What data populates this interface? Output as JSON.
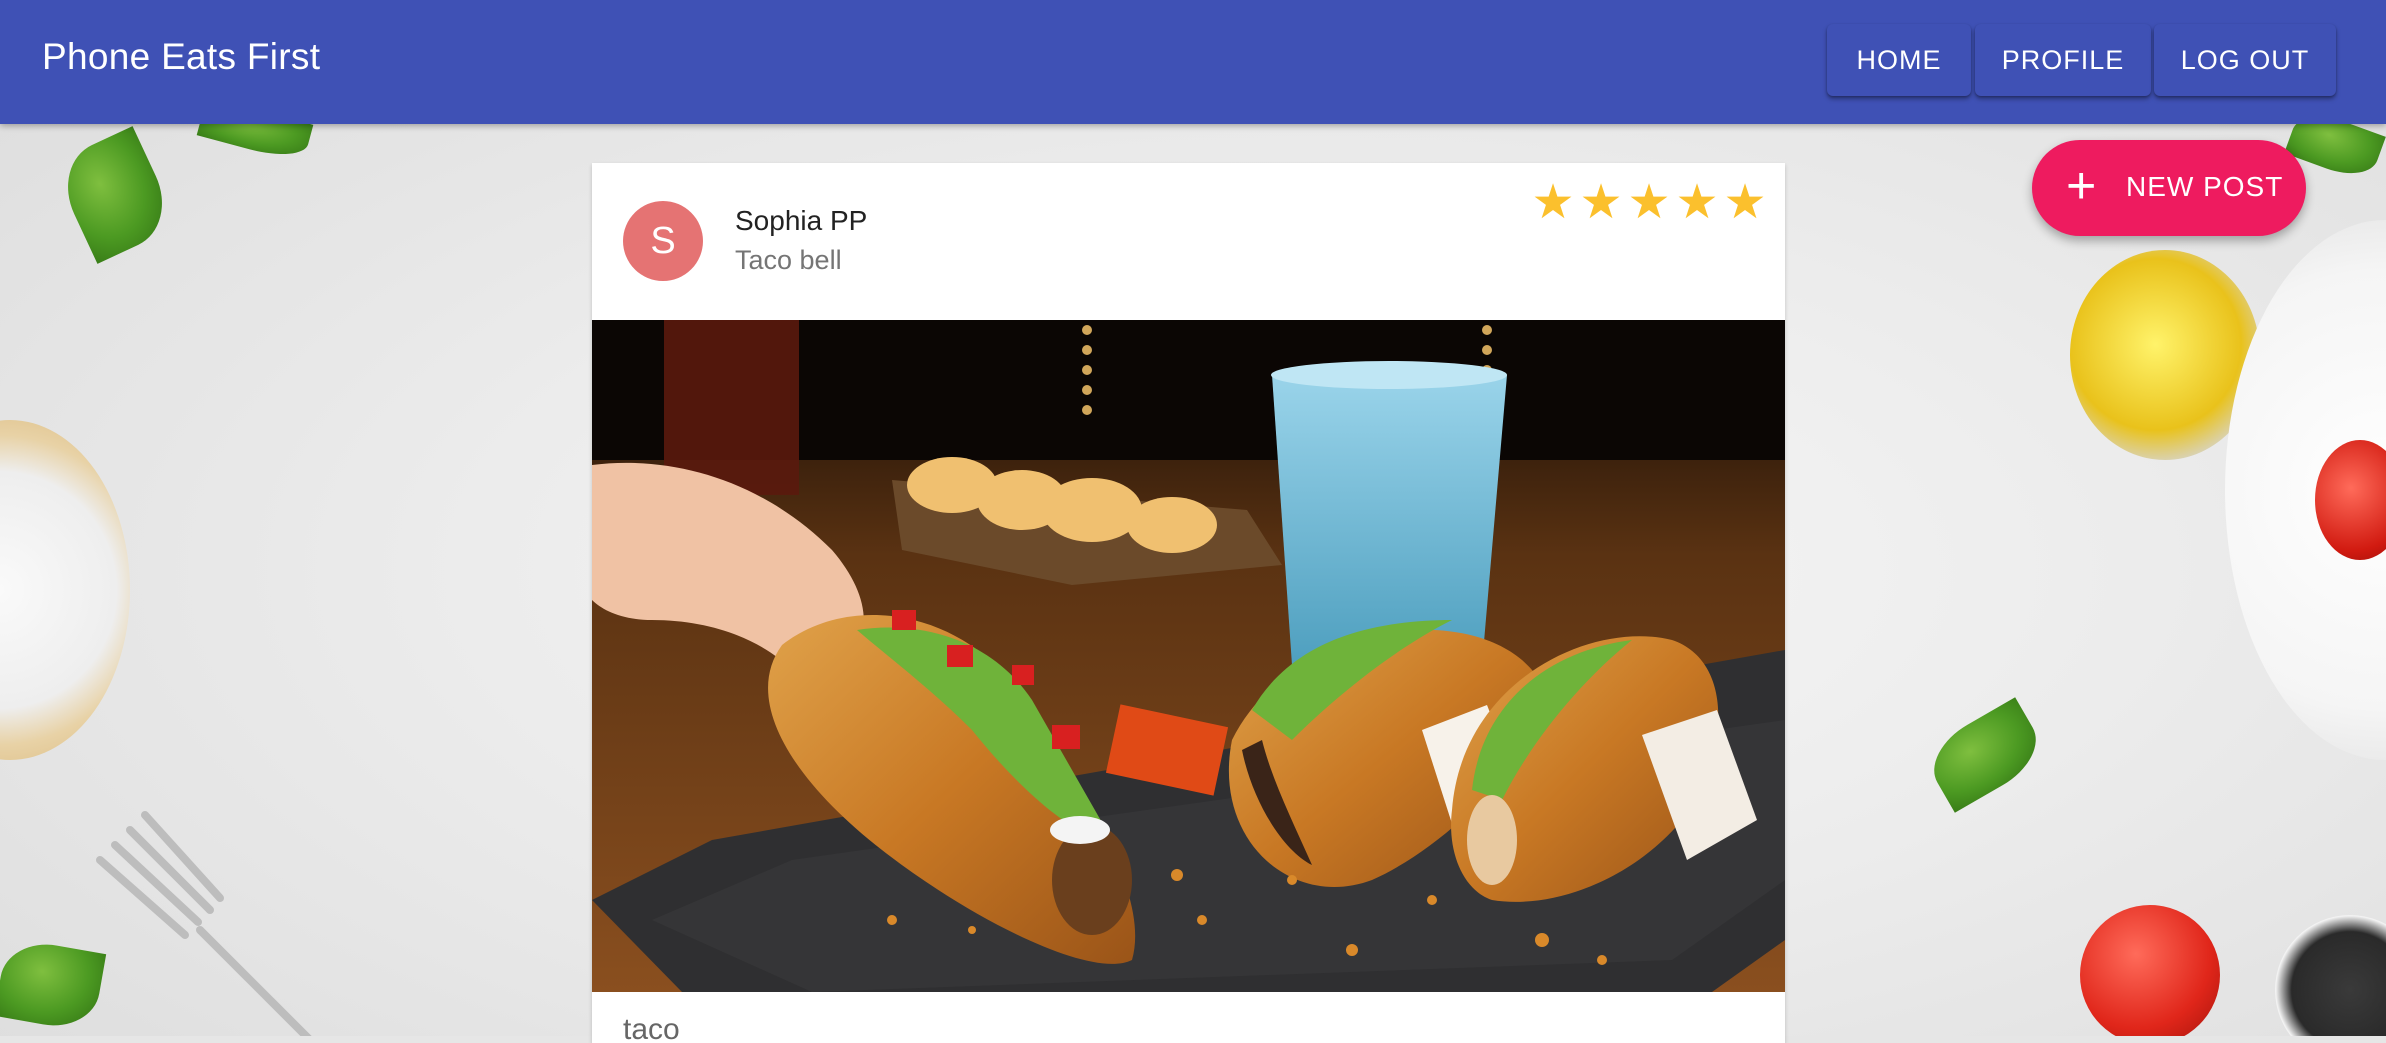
{
  "app": {
    "title": "Phone Eats First"
  },
  "nav": {
    "items": [
      {
        "label": "HOME"
      },
      {
        "label": "PROFILE"
      },
      {
        "label": "LOG OUT"
      }
    ]
  },
  "fab": {
    "label": "NEW POST",
    "icon": "plus-icon"
  },
  "post": {
    "avatar_letter": "S",
    "author": "Sophia PP",
    "place": "Taco bell",
    "rating": 5,
    "rating_max": 5,
    "caption": "taco"
  },
  "colors": {
    "appbar": "#3f51b5",
    "fab": "#ee1b5f",
    "avatar": "#e57373",
    "star": "#fbc02d"
  }
}
